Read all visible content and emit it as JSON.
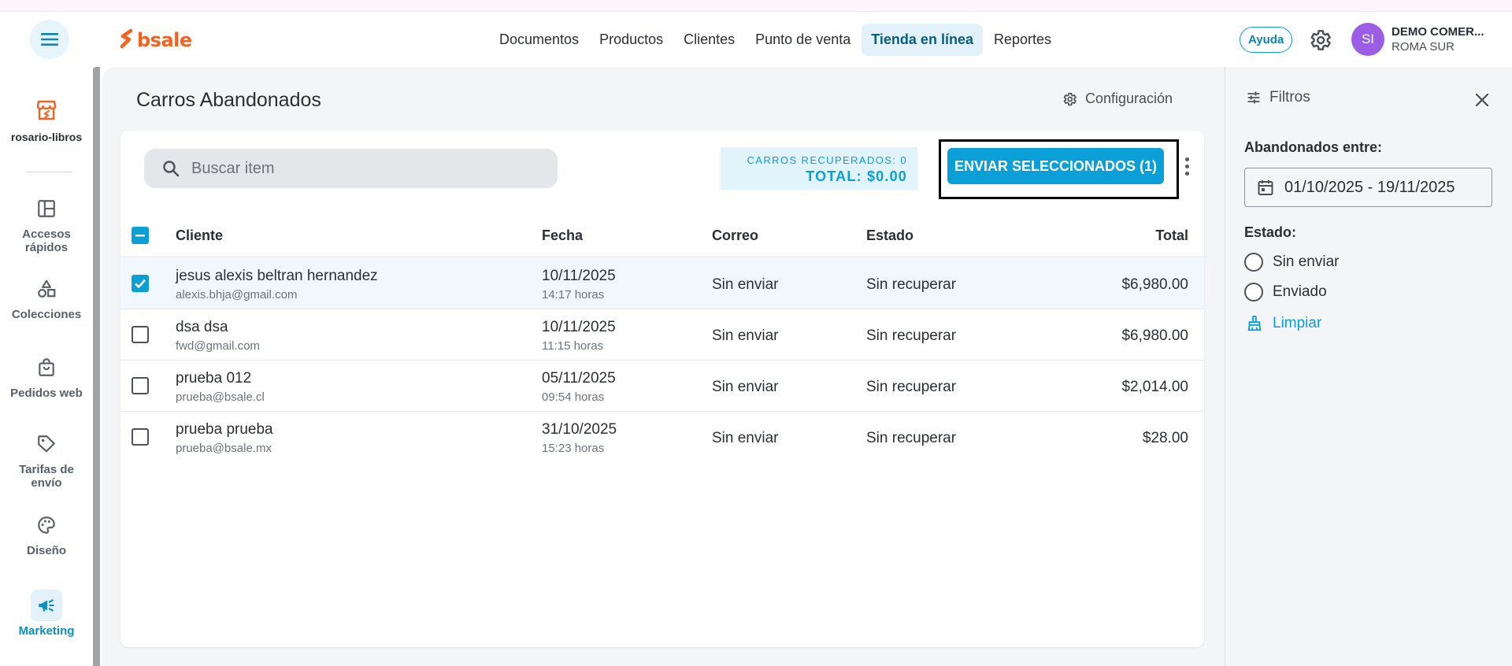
{
  "app": {
    "brand": "bsale",
    "brand_color": "#f26322",
    "accent_color": "#0a9fd6"
  },
  "nav": {
    "items": [
      {
        "label": "Documentos",
        "active": false
      },
      {
        "label": "Productos",
        "active": false
      },
      {
        "label": "Clientes",
        "active": false
      },
      {
        "label": "Punto de venta",
        "active": false
      },
      {
        "label": "Tienda en línea",
        "active": true
      },
      {
        "label": "Reportes",
        "active": false
      }
    ],
    "help_label": "Ayuda",
    "avatar_initials": "SI",
    "company_name": "DEMO COMER...",
    "company_branch": "ROMA SUR"
  },
  "sidebar": {
    "store_name": "rosario-libros",
    "items": [
      {
        "label_line1": "Accesos",
        "label_line2": "rápidos",
        "icon": "dashboard-icon"
      },
      {
        "label_line1": "Colecciones",
        "label_line2": "",
        "icon": "shapes-icon"
      },
      {
        "label_line1": "Pedidos web",
        "label_line2": "",
        "icon": "shopping-bag-icon"
      },
      {
        "label_line1": "Tarifas de",
        "label_line2": "envío",
        "icon": "tag-icon"
      },
      {
        "label_line1": "Diseño",
        "label_line2": "",
        "icon": "palette-icon"
      },
      {
        "label_line1": "Marketing",
        "label_line2": "",
        "icon": "megaphone-icon",
        "active": true
      }
    ]
  },
  "page": {
    "title": "Carros Abandonados",
    "config_label": "Configuración"
  },
  "toolbar": {
    "search_placeholder": "Buscar item",
    "recovered_label": "CARROS RECUPERADOS: 0",
    "recovered_total": "TOTAL: $0.00",
    "send_label": "ENVIAR SELECCIONADOS (1)"
  },
  "table": {
    "headers": {
      "client": "Cliente",
      "date": "Fecha",
      "mail": "Correo",
      "state": "Estado",
      "total": "Total"
    },
    "rows": [
      {
        "name": "jesus alexis beltran hernandez",
        "email": "alexis.bhja@gmail.com",
        "date": "10/11/2025",
        "time": "14:17 horas",
        "mail_status": "Sin enviar",
        "state": "Sin recuperar",
        "total": "$6,980.00",
        "checked": true
      },
      {
        "name": "dsa dsa",
        "email": "fwd@gmail.com",
        "date": "10/11/2025",
        "time": "11:15 horas",
        "mail_status": "Sin enviar",
        "state": "Sin recuperar",
        "total": "$6,980.00",
        "checked": false
      },
      {
        "name": "prueba 012",
        "email": "prueba@bsale.cl",
        "date": "05/11/2025",
        "time": "09:54 horas",
        "mail_status": "Sin enviar",
        "state": "Sin recuperar",
        "total": "$2,014.00",
        "checked": false
      },
      {
        "name": "prueba prueba",
        "email": "prueba@bsale.mx",
        "date": "31/10/2025",
        "time": "15:23 horas",
        "mail_status": "Sin enviar",
        "state": "Sin recuperar",
        "total": "$28.00",
        "checked": false
      }
    ]
  },
  "filters": {
    "title": "Filtros",
    "range_label": "Abandonados entre:",
    "date_range": "01/10/2025 - 19/11/2025",
    "state_label": "Estado:",
    "options": [
      "Sin enviar",
      "Enviado"
    ],
    "clear_label": "Limpiar"
  }
}
